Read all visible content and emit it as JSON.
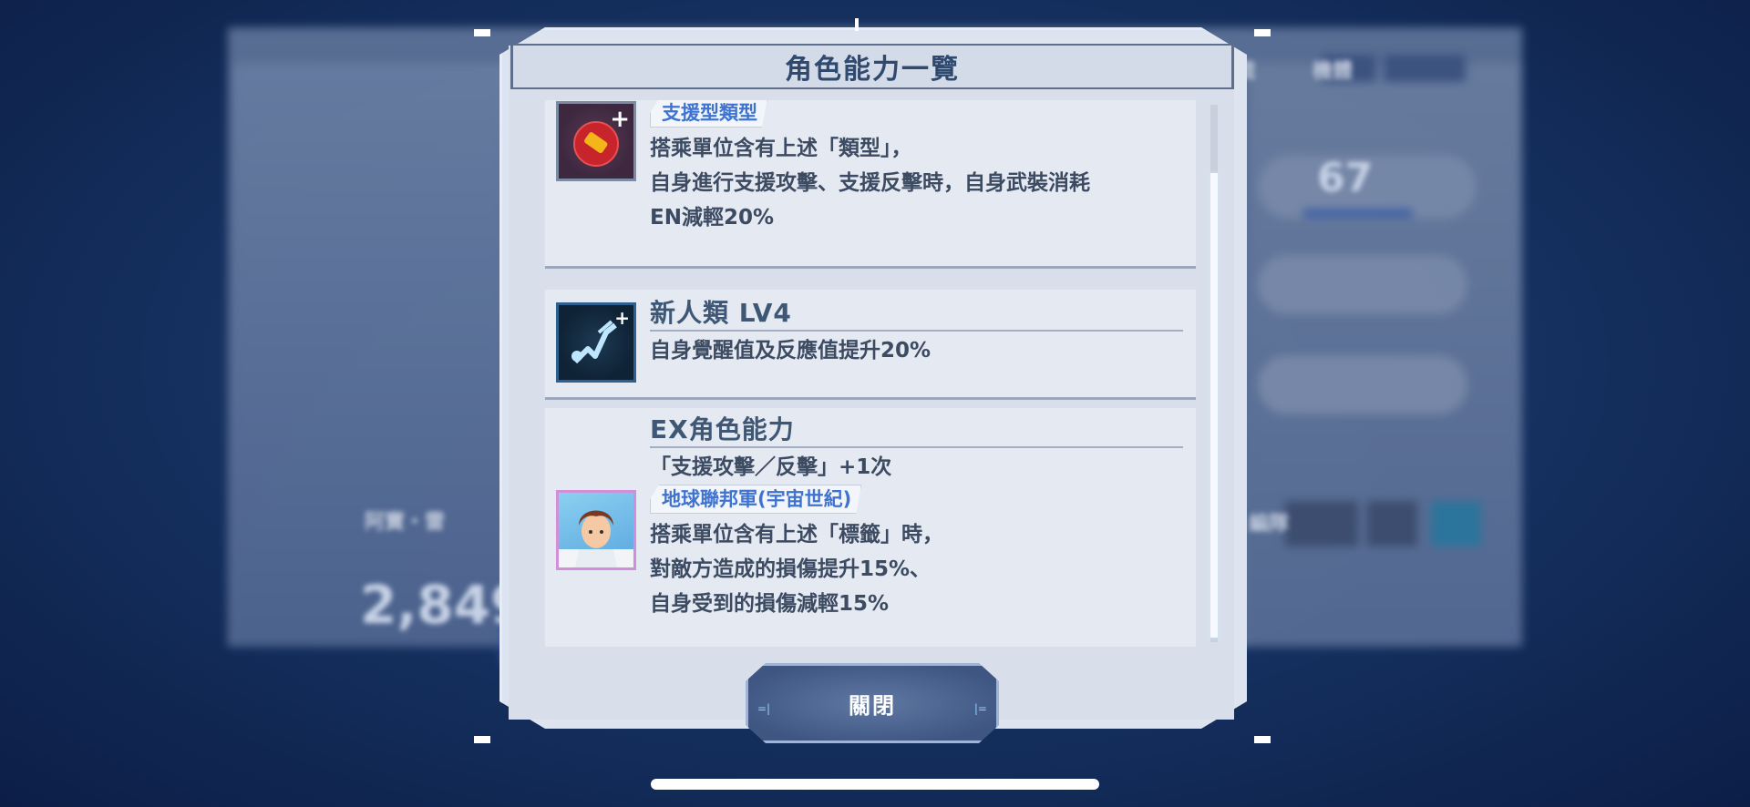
{
  "background": {
    "left_power_value": "2,849",
    "left_name": "阿寶・雷",
    "right_level_value": "67",
    "tab_a": "戰",
    "tab_b": "機體",
    "right_label": "編隊"
  },
  "dialog": {
    "title": "角色能力一覽",
    "abilities": [
      {
        "icon": "support-type-icon",
        "tag": "支援型類型",
        "lines": [
          "搭乘單位含有上述「類型」，",
          "自身進行支援攻擊、支援反擊時，自身武裝消耗",
          "EN減輕20%"
        ]
      },
      {
        "icon": "newtype-icon",
        "name": "新人類 LV4",
        "lines": [
          "自身覺醒值及反應值提升20%"
        ]
      },
      {
        "icon": "pilot-portrait-icon",
        "name": "EX角色能力",
        "subtitle": "「支援攻擊／反擊」+1次",
        "tag": "地球聯邦軍(宇宙世紀)",
        "lines": [
          "搭乘單位含有上述「標籤」時，",
          "對敵方造成的損傷提升15%、",
          "自身受到的損傷減輕15%"
        ]
      }
    ],
    "close_label": "關閉"
  },
  "colors": {
    "accent_tag": "#3f73d0",
    "title_text": "#2f4a6e",
    "frame_glow": "#c8e1ff"
  }
}
